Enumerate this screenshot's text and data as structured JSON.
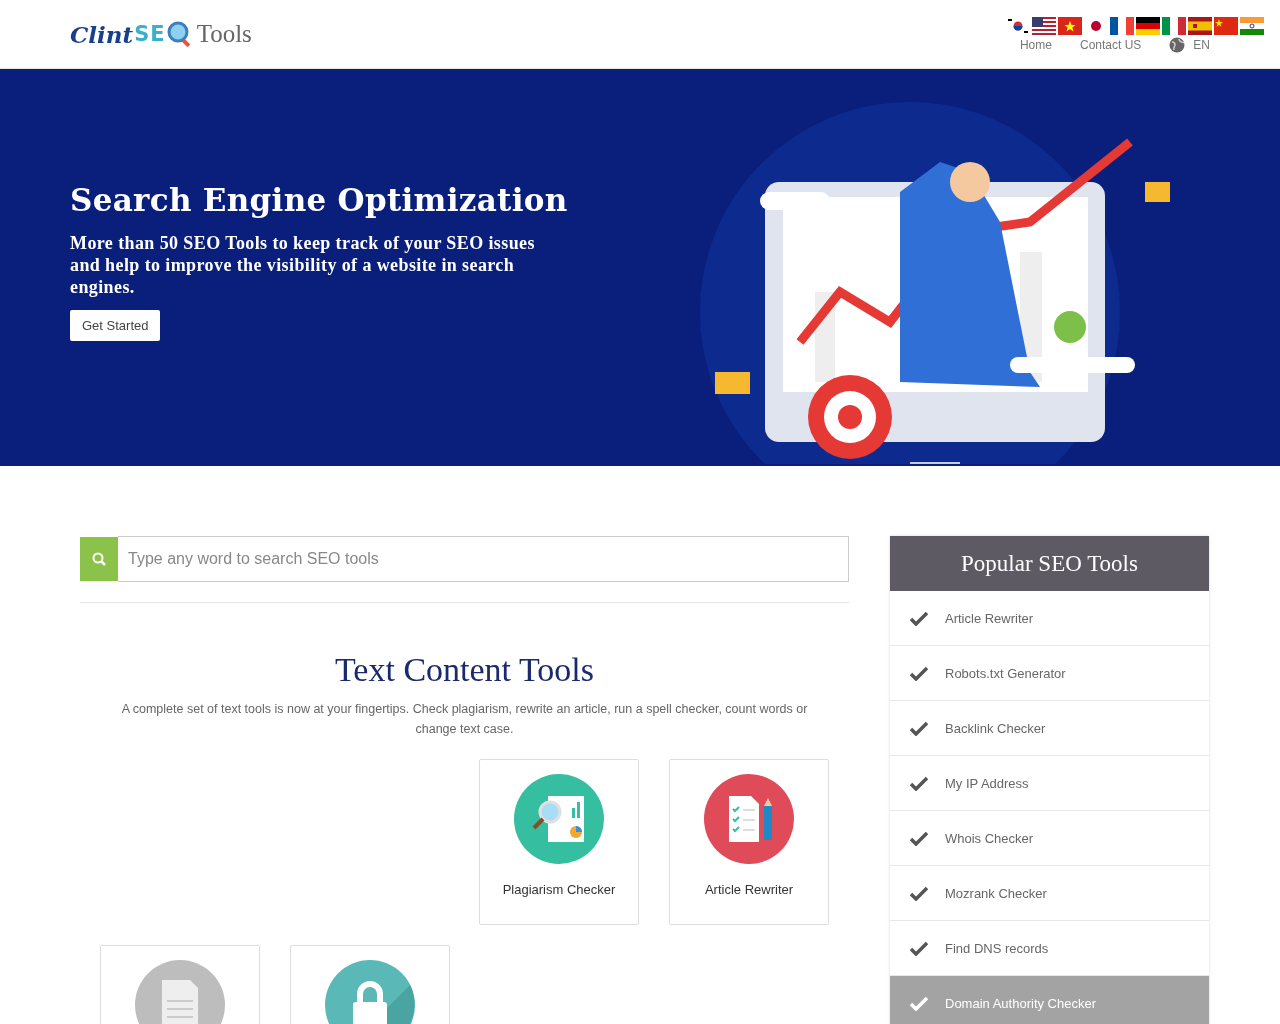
{
  "logo": {
    "part1": "Clint",
    "part2": "SE",
    "part3": "Tools"
  },
  "language_flags": [
    {
      "kind": "kr"
    },
    {
      "kind": "us"
    },
    {
      "kind": "vn"
    },
    {
      "kind": "jp"
    },
    {
      "kind": "fr"
    },
    {
      "kind": "de"
    },
    {
      "kind": "it"
    },
    {
      "kind": "es"
    },
    {
      "kind": "cn"
    },
    {
      "kind": "in"
    }
  ],
  "nav": [
    {
      "label": "Home",
      "kind": "link"
    },
    {
      "label": "Contact US",
      "kind": "link"
    },
    {
      "label": "EN",
      "kind": "language"
    }
  ],
  "hero": {
    "title": "Search Engine Optimization",
    "subtitle": "More than 50 SEO Tools to keep track of your SEO issues and help to improve the visibility of a website in search engines.",
    "button": "Get Started"
  },
  "search": {
    "placeholder": "Type any word to search SEO tools"
  },
  "section": {
    "title": "Text Content Tools",
    "description": "A complete set of text tools is now at your fingertips. Check plagiarism, rewrite an article, run a spell checker, count words or change text case."
  },
  "tool_rows": [
    [
      {
        "name": "Plagiarism Checker",
        "kind": "plagiarism"
      },
      {
        "name": "Article Rewriter",
        "kind": "rewriter"
      }
    ],
    [
      {
        "kind": "document"
      },
      {
        "kind": "lock"
      }
    ]
  ],
  "sidebar": {
    "title": "Popular SEO Tools",
    "items": [
      {
        "label": "Article Rewriter",
        "selected": false
      },
      {
        "label": "Robots.txt Generator",
        "selected": false
      },
      {
        "label": "Backlink Checker",
        "selected": false
      },
      {
        "label": "My IP Address",
        "selected": false
      },
      {
        "label": "Whois Checker",
        "selected": false
      },
      {
        "label": "Mozrank Checker",
        "selected": false
      },
      {
        "label": "Find DNS records",
        "selected": false
      },
      {
        "label": "Domain Authority Checker",
        "selected": true
      }
    ]
  }
}
